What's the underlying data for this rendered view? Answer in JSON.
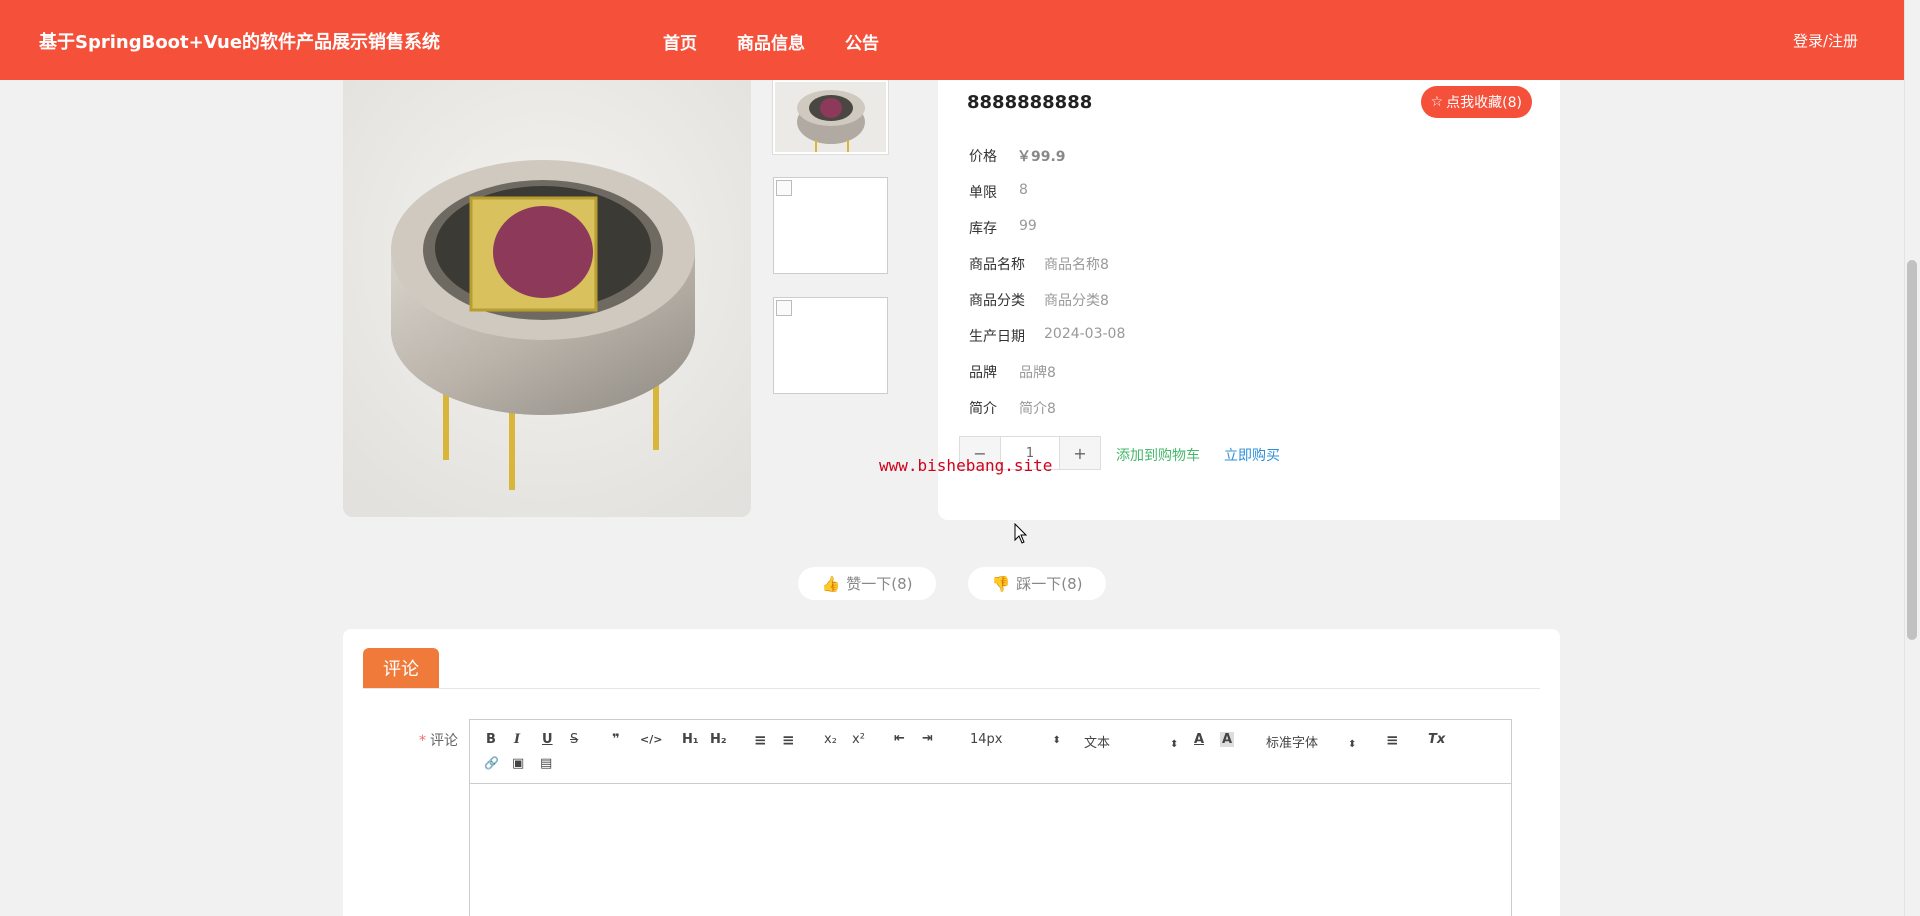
{
  "header": {
    "brand": "基于SpringBoot+Vue的软件产品展示销售系统",
    "nav": [
      "首页",
      "商品信息",
      "公告"
    ],
    "login": "登录/注册"
  },
  "product": {
    "name": "8888888888",
    "favorite_label": "点我收藏(8)",
    "fields": [
      {
        "k": "价格",
        "v": "￥99.9"
      },
      {
        "k": "单限",
        "v": "8"
      },
      {
        "k": "库存",
        "v": "99"
      },
      {
        "k": "商品名称",
        "v": "商品名称8"
      },
      {
        "k": "商品分类",
        "v": "商品分类8"
      },
      {
        "k": "生产日期",
        "v": "2024-03-08"
      },
      {
        "k": "品牌",
        "v": "品牌8"
      },
      {
        "k": "简介",
        "v": "简介8"
      }
    ],
    "quantity": "1",
    "minus": "−",
    "plus": "+",
    "add_to_cart": "添加到购物车",
    "buy_now": "立即购买"
  },
  "watermark": "www.bishebang.site",
  "votes": {
    "like": "赞一下(8)",
    "dislike": "踩一下(8)"
  },
  "comment": {
    "tab": "评论",
    "label": "评论",
    "required_mark": "*",
    "toolbar": {
      "bold": "B",
      "italic": "I",
      "underline": "U",
      "strike": "S",
      "quote": "❞",
      "code": "</>",
      "h1": "H₁",
      "h2": "H₂",
      "ol": "≡",
      "ul": "≡",
      "sub": "x₂",
      "sup": "x²",
      "outdent": "⇤",
      "indent": "⇥",
      "size": "14px",
      "type": "文本",
      "font": "标准字体",
      "color": "A",
      "bg": "A",
      "align": "≡",
      "clean": "Tx",
      "link": "🔗",
      "image": "▣",
      "video": "▤"
    }
  },
  "colors": {
    "header": "#f5503a",
    "tab": "#f07a3a",
    "add_to_cart": "#46b86b",
    "buy_now": "#2e8fd8",
    "watermark": "#d0021b"
  }
}
